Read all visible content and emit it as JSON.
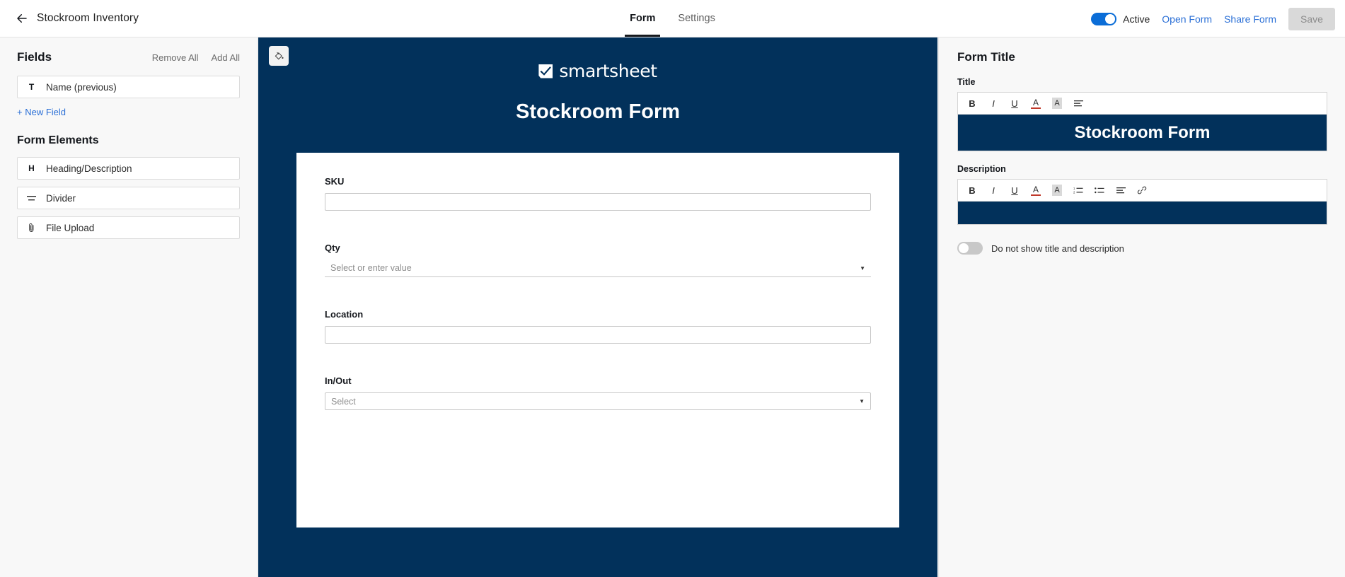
{
  "header": {
    "back_icon": "arrow-left-icon",
    "doc_title": "Stockroom Inventory",
    "tabs": [
      {
        "label": "Form",
        "active": true
      },
      {
        "label": "Settings",
        "active": false
      }
    ],
    "active_toggle": {
      "state": "on",
      "label": "Active"
    },
    "open_form_label": "Open Form",
    "share_form_label": "Share Form",
    "save_label": "Save",
    "save_enabled": false,
    "accent_blue": "#2a6fd6"
  },
  "sidebar": {
    "fields_title": "Fields",
    "remove_all_label": "Remove All",
    "add_all_label": "Add All",
    "fields": [
      {
        "icon": "text-field-icon",
        "glyph": "T",
        "label": "Name (previous)"
      }
    ],
    "new_field_label": "+ New Field",
    "form_elements_title": "Form Elements",
    "elements": [
      {
        "icon": "heading-icon",
        "glyph": "H",
        "label": "Heading/Description"
      },
      {
        "icon": "divider-icon",
        "glyph": "≡",
        "label": "Divider"
      },
      {
        "icon": "paperclip-icon",
        "glyph": "📎",
        "label": "File Upload"
      }
    ]
  },
  "canvas": {
    "paint_icon": "paint-bucket-icon",
    "background_color": "#02315b",
    "brand_name": "smartsheet",
    "brand_mark": "checkbox-check-icon",
    "form_heading": "Stockroom Form",
    "fields": [
      {
        "label": "SKU",
        "type": "text",
        "value": "",
        "placeholder": ""
      },
      {
        "label": "Qty",
        "type": "combo",
        "value": "",
        "placeholder": "Select or enter value"
      },
      {
        "label": "Location",
        "type": "text",
        "value": "",
        "placeholder": ""
      },
      {
        "label": "In/Out",
        "type": "select",
        "value": "",
        "placeholder": "Select"
      }
    ]
  },
  "right_panel": {
    "title": "Form Title",
    "title_field_label": "Title",
    "title_toolbar": [
      {
        "name": "bold-icon",
        "glyph": "B"
      },
      {
        "name": "italic-icon",
        "glyph": "I"
      },
      {
        "name": "underline-icon",
        "glyph": "U"
      },
      {
        "name": "text-color-icon",
        "glyph": "A"
      },
      {
        "name": "highlight-color-icon",
        "glyph": "A"
      },
      {
        "name": "align-icon",
        "glyph": "≡"
      }
    ],
    "title_value": "Stockroom Form",
    "description_field_label": "Description",
    "description_toolbar": [
      {
        "name": "bold-icon",
        "glyph": "B"
      },
      {
        "name": "italic-icon",
        "glyph": "I"
      },
      {
        "name": "underline-icon",
        "glyph": "U"
      },
      {
        "name": "text-color-icon",
        "glyph": "A"
      },
      {
        "name": "highlight-color-icon",
        "glyph": "A"
      },
      {
        "name": "numbered-list-icon",
        "glyph": "≣"
      },
      {
        "name": "bullet-list-icon",
        "glyph": "≣"
      },
      {
        "name": "align-icon",
        "glyph": "≡"
      },
      {
        "name": "link-icon",
        "glyph": "🔗"
      }
    ],
    "description_value": "",
    "hide_toggle": {
      "state": "off",
      "label": "Do not show title and description"
    },
    "editor_background": "#02315b"
  }
}
